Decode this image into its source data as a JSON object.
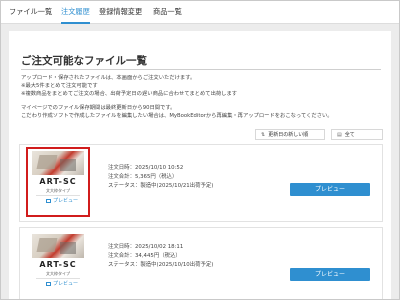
{
  "nav": {
    "tabs": [
      {
        "label": "ファイル一覧",
        "active": false
      },
      {
        "label": "注文履歴",
        "active": true
      },
      {
        "label": "登録情報変更",
        "active": false
      },
      {
        "label": "商品一覧",
        "active": false
      }
    ]
  },
  "main": {
    "title": "ご注文可能なファイル一覧",
    "desc": [
      "アップロード・保存されたファイルは、本画面からご注文いただけます。",
      "※最大5件まとめて注文可能です",
      "※複数商品をまとめてご注文の場合、出荷予定日の遅い商品に合わせてまとめて出荷します",
      "マイページでのファイル保存期間は最終更新日から90日間です。",
      "こだわり作成ソフトで作成したファイルを編集したい場合は、MyBookEditorから再編集・再アップロードをおこなってください。"
    ],
    "sort_label": "更新日の新しい順",
    "filter_label": "全て"
  },
  "cards": [
    {
      "art": "ART-SC",
      "sub": "文大枠タイプ",
      "preview_link": "プレビュー",
      "date": "注文日時：2025/10/10 10:52",
      "amount": "注文合計：5,365円（税込）",
      "status": "ステータス：製造中(2025/10/21出荷予定)",
      "button": "プレビュー",
      "highlighted": true
    },
    {
      "art": "ART-SC",
      "sub": "文大枠タイプ",
      "preview_link": "プレビュー",
      "date": "注文日時：2025/10/02 18:11",
      "amount": "注文合計：34,445円（税込）",
      "status": "ステータス：製造中(2025/10/10出荷予定)",
      "button": "プレビュー",
      "highlighted": false
    }
  ],
  "colors": {
    "accent": "#2f8fd0",
    "highlight": "#d11c1c",
    "page_bg": "#ececec"
  },
  "icons": {
    "sort": "sort-icon",
    "filter": "filter-icon",
    "preview": "preview-icon"
  }
}
